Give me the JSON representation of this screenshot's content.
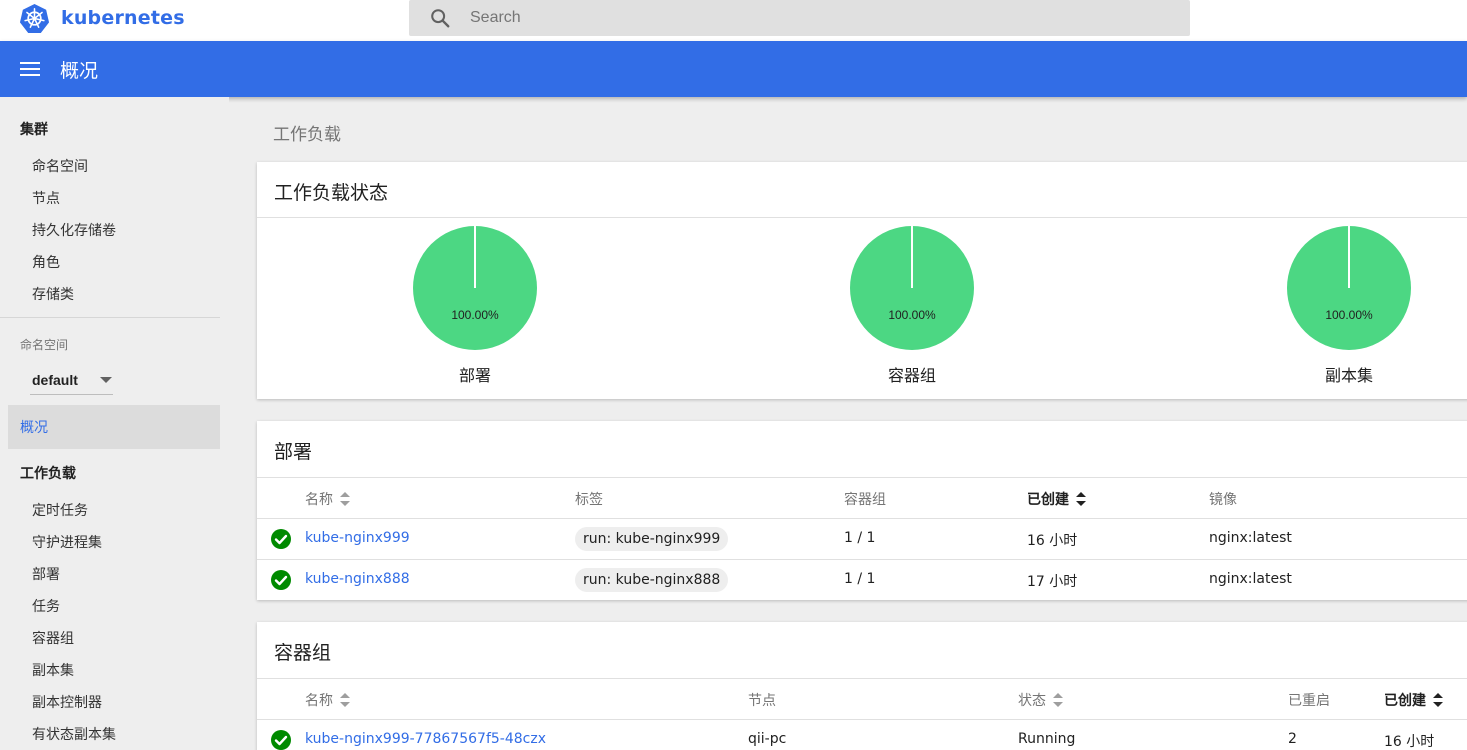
{
  "app": {
    "brand": "kubernetes",
    "search_placeholder": "Search",
    "header_title": "概况"
  },
  "colors": {
    "primary": "#326de6",
    "healthy": "#4cd783",
    "ok_icon": "#008a00"
  },
  "sidebar": {
    "cluster_heading": "集群",
    "cluster_items": [
      "命名空间",
      "节点",
      "持久化存储卷",
      "角色",
      "存储类"
    ],
    "namespace_label": "命名空间",
    "namespace_value": "default",
    "overview": "概况",
    "workloads_heading": "工作负载",
    "workload_items": [
      "定时任务",
      "守护进程集",
      "部署",
      "任务",
      "容器组",
      "副本集",
      "副本控制器",
      "有状态副本集"
    ]
  },
  "main": {
    "page_title": "工作负载",
    "status_card": {
      "title": "工作负载状态",
      "pies": [
        {
          "label": "部署",
          "percent_text": "100.00%",
          "percent": 100
        },
        {
          "label": "容器组",
          "percent_text": "100.00%",
          "percent": 100
        },
        {
          "label": "副本集",
          "percent_text": "100.00%",
          "percent": 100
        }
      ]
    },
    "deployments": {
      "title": "部署",
      "headers": [
        "名称",
        "标签",
        "容器组",
        "已创建",
        "镜像"
      ],
      "rows": [
        {
          "name": "kube-nginx999",
          "label": "run: kube-nginx999",
          "pods": "1 / 1",
          "created": "16 小时",
          "image": "nginx:latest"
        },
        {
          "name": "kube-nginx888",
          "label": "run: kube-nginx888",
          "pods": "1 / 1",
          "created": "17 小时",
          "image": "nginx:latest"
        }
      ]
    },
    "pods": {
      "title": "容器组",
      "headers": [
        "名称",
        "节点",
        "状态",
        "已重启",
        "已创建"
      ],
      "rows": [
        {
          "name": "kube-nginx999-77867567f5-48czx",
          "node": "qii-pc",
          "status": "Running",
          "restarts": "2",
          "created": "16 小时"
        }
      ]
    }
  }
}
